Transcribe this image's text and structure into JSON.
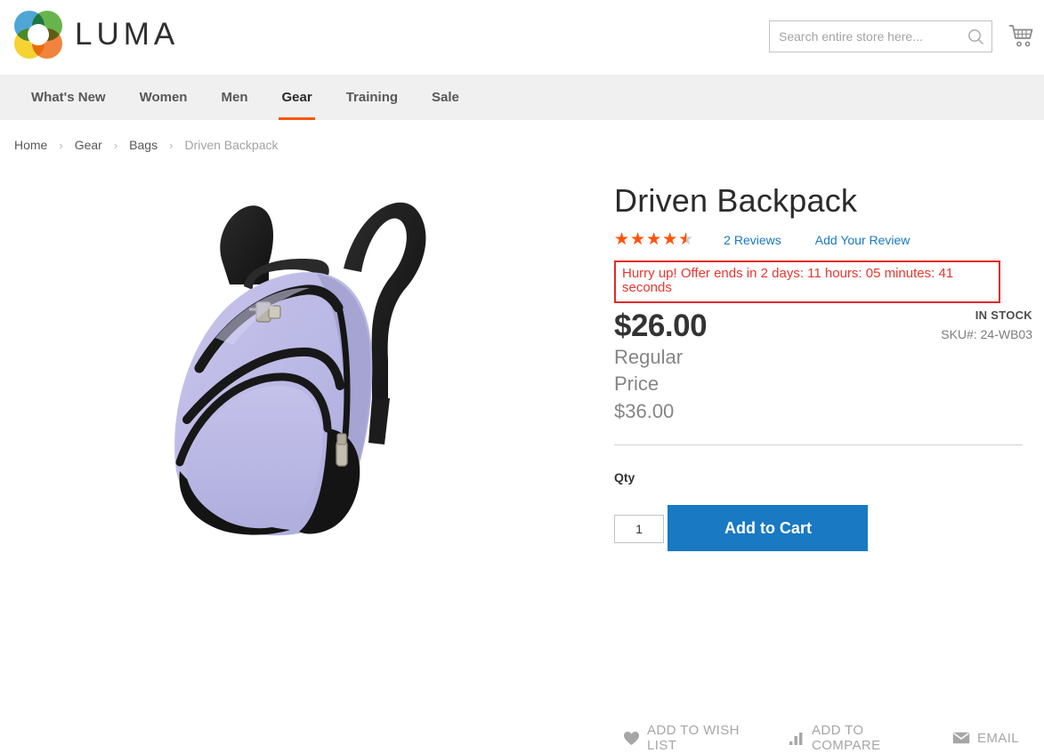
{
  "header": {
    "logo_text": "LUMA",
    "logo_icon": "luma-flower-logo",
    "search": {
      "placeholder": "Search entire store here...",
      "value": "",
      "icon": "search-icon"
    },
    "cart_icon": "shopping-cart-icon"
  },
  "nav": {
    "items": [
      {
        "label": "What's New",
        "active": false
      },
      {
        "label": "Women",
        "active": false
      },
      {
        "label": "Men",
        "active": false
      },
      {
        "label": "Gear",
        "active": true
      },
      {
        "label": "Training",
        "active": false
      },
      {
        "label": "Sale",
        "active": false
      }
    ],
    "active_underline_color": "#ff5501"
  },
  "breadcrumb": {
    "separator": "›",
    "items": [
      {
        "label": "Home",
        "current": false
      },
      {
        "label": "Gear",
        "current": false
      },
      {
        "label": "Bags",
        "current": false
      },
      {
        "label": "Driven Backpack",
        "current": true
      }
    ]
  },
  "product": {
    "title": "Driven Backpack",
    "image_alt": "driven-backpack-product-image",
    "rating": {
      "percent": 90,
      "stars_glyphs": "★★★★★",
      "star_color": "#ff5501",
      "empty_star_color": "#c7c7c7",
      "reviews_link": "2 Reviews",
      "add_review_link": "Add Your Review"
    },
    "countdown": {
      "text": "Hurry up! Offer ends in 2 days: 11 hours: 05 minutes: 41 seconds",
      "border_color": "#e02b27",
      "text_color": "#e8362f"
    },
    "price": {
      "special": "$26.00",
      "regular_label": "Regular Price",
      "regular_value": "$36.00"
    },
    "availability": "IN STOCK",
    "sku_label": "SKU#:",
    "sku_value": "24-WB03",
    "qty": {
      "label": "Qty",
      "value": "1"
    },
    "add_to_cart_label": "Add to Cart",
    "add_to_cart_color": "#1979c3",
    "actions": [
      {
        "label": "ADD TO WISH LIST",
        "icon": "heart-icon"
      },
      {
        "label": "ADD TO COMPARE",
        "icon": "bar-chart-icon"
      },
      {
        "label": "EMAIL",
        "icon": "envelope-icon"
      }
    ]
  }
}
